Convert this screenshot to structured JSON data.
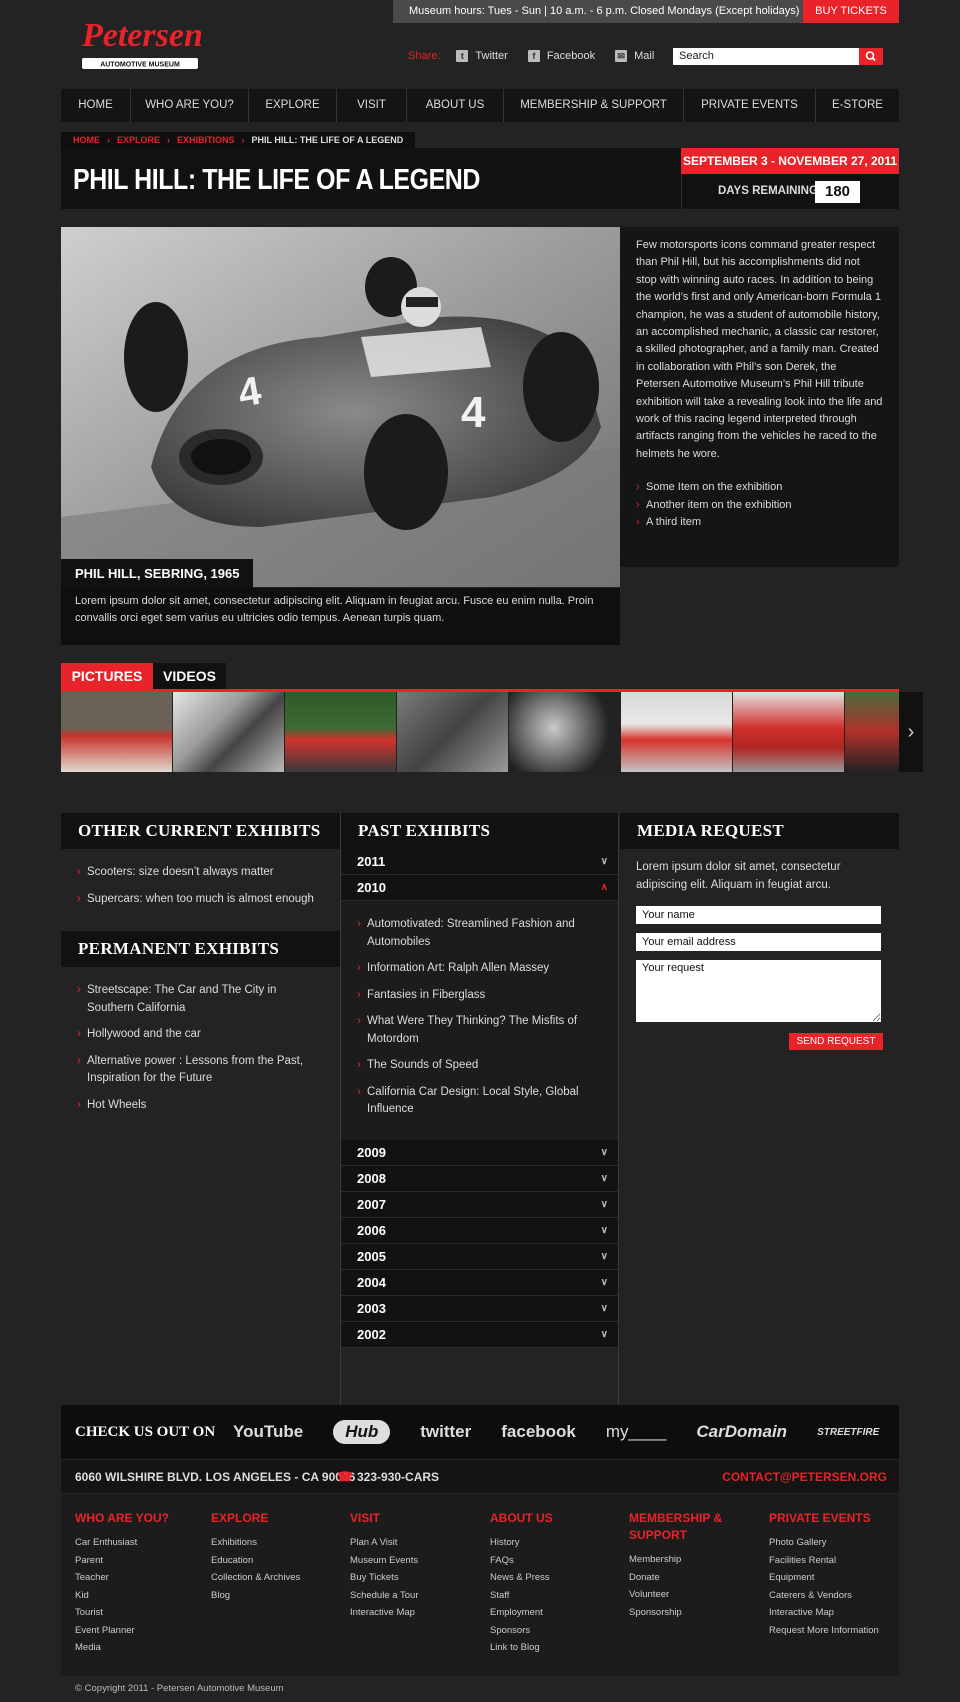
{
  "header": {
    "logo_text": "Petersen",
    "logo_sub": "AUTOMOTIVE MUSEUM",
    "hours": "Museum hours: Tues - Sun | 10 a.m. - 6 p.m. Closed Mondays (Except holidays)",
    "buy_tickets": "BUY TICKETS",
    "share_label": "Share:",
    "share": [
      "Twitter",
      "Facebook",
      "Mail"
    ],
    "search_placeholder": "Search"
  },
  "nav": [
    "HOME",
    "WHO ARE YOU?",
    "EXPLORE",
    "VISIT",
    "ABOUT US",
    "MEMBERSHIP & SUPPORT",
    "PRIVATE EVENTS",
    "E-STORE"
  ],
  "breadcrumb": [
    "HOME",
    "EXPLORE",
    "EXHIBITIONS",
    "PHIL HILL: THE LIFE OF A LEGEND"
  ],
  "exhibit": {
    "title": "PHIL HILL: THE LIFE OF A LEGEND",
    "dates": "SEPTEMBER 3 - NOVEMBER 27, 2011",
    "days_label": "DAYS REMAINING",
    "days_value": "180",
    "photo_caption": "PHIL HILL, SEBRING, 1965",
    "caption_text": "Lorem ipsum dolor sit amet, consectetur adipiscing elit. Aliquam in feugiat arcu. Fusce eu enim nulla. Proin convallis orci eget sem varius eu ultricies odio tempus. Aenean turpis quam.",
    "description": "Few motorsports icons command greater respect than Phil Hill, but his accomplishments did not stop with winning auto races. In addition to being the world’s first and only American-born Formula 1 champion, he was a student of automobile history, an accomplished mechanic, a classic car restorer, a skilled photographer, and a family man. Created in collaboration with Phil’s son Derek, the Petersen Automotive Museum’s Phil Hill tribute exhibition will take a revealing look into the life and work of this racing legend interpreted through artifacts ranging from the vehicles he raced to the helmets he wore.",
    "items": [
      "Some Item on the exhibition",
      "Another item on the exhibition",
      "A third item"
    ]
  },
  "media_tabs": [
    "PICTURES",
    "VIDEOS"
  ],
  "other_current": {
    "title": "OTHER CURRENT EXHIBITS",
    "items": [
      "Scooters: size doesn’t always matter",
      "Supercars: when too much is almost enough"
    ]
  },
  "permanent": {
    "title": "PERMANENT EXHIBITS",
    "items": [
      "Streetscape: The Car and The City in Southern California",
      "Hollywood and the car",
      "Alternative power : Lessons from the Past, Inspiration for the Future",
      "Hot Wheels"
    ]
  },
  "past": {
    "title": "PAST EXHIBITS",
    "years_before": [
      "2011",
      "2010"
    ],
    "open_items": [
      "Automotivated: Streamlined Fashion and Automobiles",
      "Information Art: Ralph Allen Massey",
      "Fantasies in Fiberglass",
      "What Were They Thinking? The Misfits of Motordom",
      "The Sounds of Speed",
      "California Car Design: Local Style, Global Influence"
    ],
    "years_after": [
      "2009",
      "2008",
      "2007",
      "2006",
      "2005",
      "2004",
      "2003",
      "2002"
    ]
  },
  "media_request": {
    "title": "MEDIA REQUEST",
    "text": "Lorem ipsum dolor sit amet, consectetur adipiscing elit. Aliquam in feugiat arcu.",
    "name_placeholder": "Your name",
    "email_placeholder": "Your email address",
    "request_placeholder": "Your request",
    "send": "SEND REQUEST"
  },
  "social": {
    "label": "CHECK US OUT ON",
    "logos": [
      "YouTube",
      "Hub",
      "twitter",
      "facebook",
      "my____",
      "CarDomain",
      "STREETFIRE"
    ]
  },
  "contact": {
    "address": "6060 WILSHIRE BLVD. LOS ANGELES - CA 90036",
    "phone": "323-930-CARS",
    "email": "CONTACT@PETERSEN.ORG"
  },
  "footer": {
    "columns": [
      {
        "title": "WHO ARE YOU?",
        "links": [
          "Car Enthusiast",
          "Parent",
          "Teacher",
          "Kid",
          "Tourist",
          "Event Planner",
          "Media"
        ]
      },
      {
        "title": "EXPLORE",
        "links": [
          "Exhibitions",
          "Education",
          "Collection & Archives",
          "Blog"
        ]
      },
      {
        "title": "VISIT",
        "links": [
          "Plan A Visit",
          "Museum Events",
          "Buy Tickets",
          "Schedule a Tour",
          "Interactive Map"
        ]
      },
      {
        "title": "ABOUT US",
        "links": [
          "History",
          "FAQs",
          "News & Press",
          "Staff",
          "Employment",
          "Sponsors",
          "Link to Blog"
        ]
      },
      {
        "title": "MEMBERSHIP & SUPPORT",
        "links": [
          "Membership",
          "Donate",
          "Volunteer",
          "Sponsorship"
        ]
      },
      {
        "title": "PRIVATE EVENTS",
        "links": [
          "Photo Gallery",
          "Facilities Rental",
          "Equipment",
          "Caterers & Vendors",
          "Interactive Map",
          "Request More Information"
        ]
      }
    ],
    "copyright": "© Copyright 2011 - Petersen Automotive Museum"
  }
}
